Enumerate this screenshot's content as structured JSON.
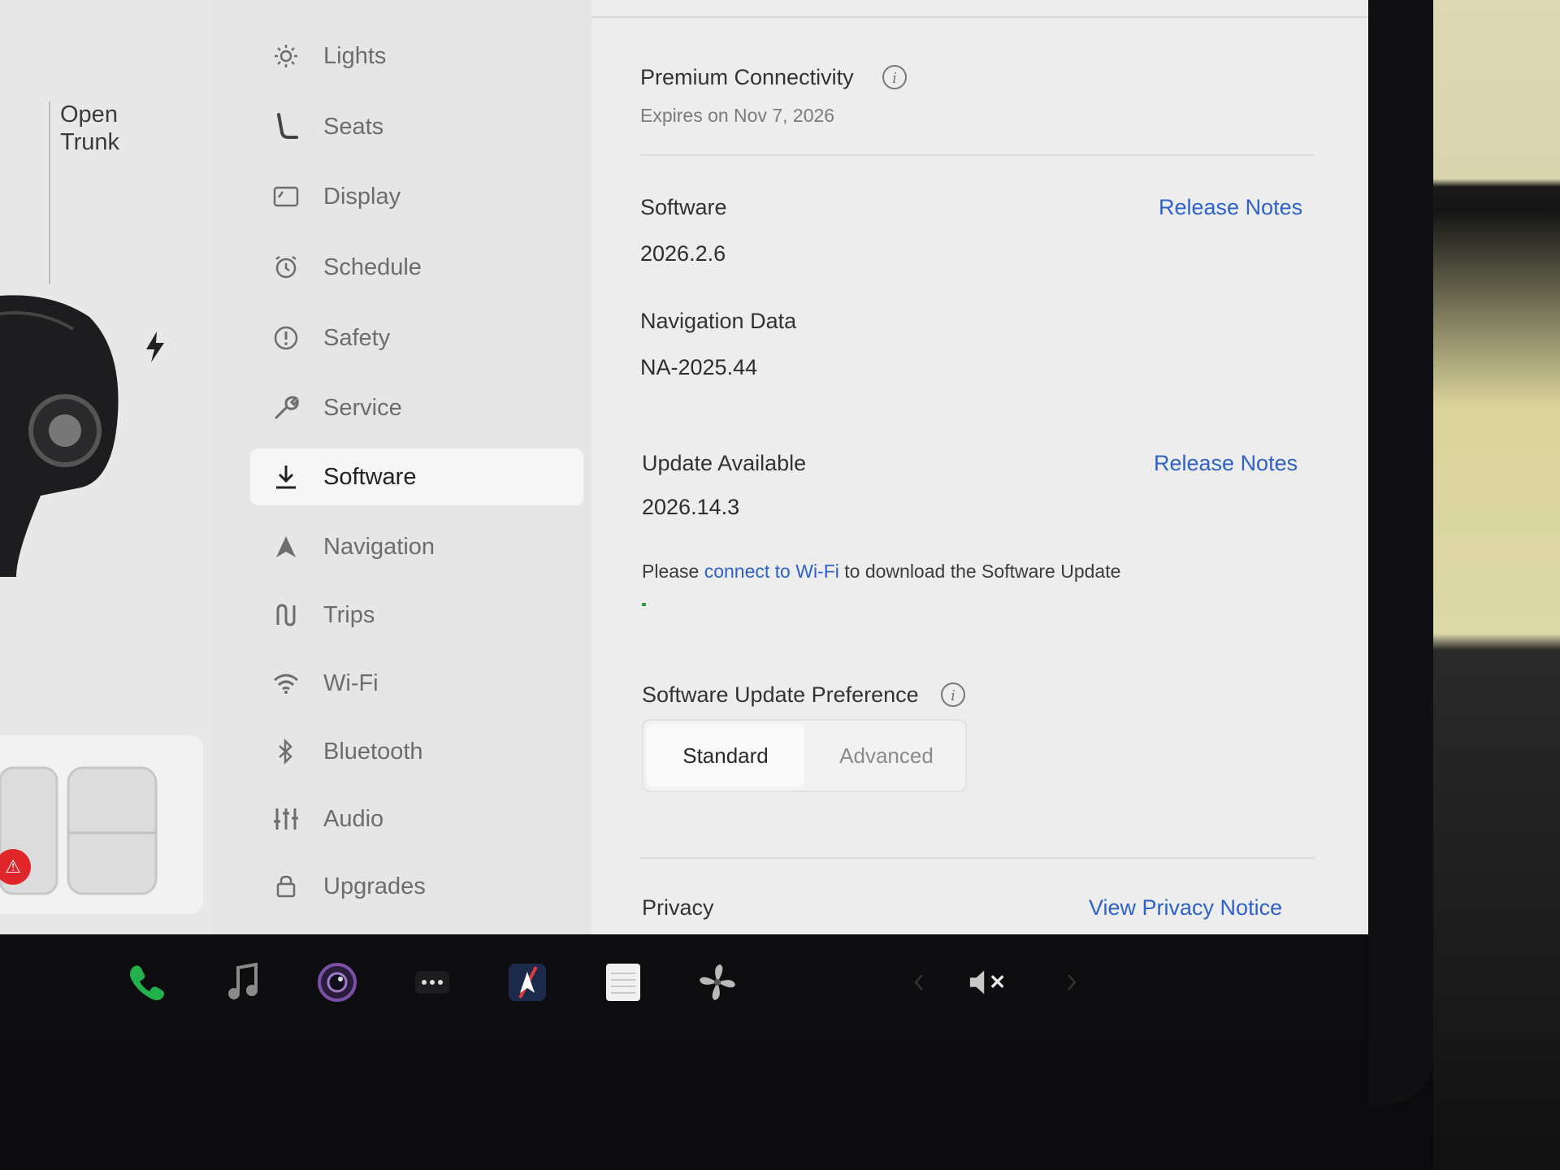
{
  "car_panel": {
    "trunk_label": "Open\nTrunk"
  },
  "menu": {
    "items": [
      {
        "label": "Lights",
        "icon": "lights-icon"
      },
      {
        "label": "Seats",
        "icon": "seat-icon"
      },
      {
        "label": "Display",
        "icon": "display-icon"
      },
      {
        "label": "Schedule",
        "icon": "schedule-icon"
      },
      {
        "label": "Safety",
        "icon": "safety-icon"
      },
      {
        "label": "Service",
        "icon": "wrench-icon"
      },
      {
        "label": "Software",
        "icon": "download-icon",
        "active": true
      },
      {
        "label": "Navigation",
        "icon": "navigation-icon"
      },
      {
        "label": "Trips",
        "icon": "trips-icon"
      },
      {
        "label": "Wi-Fi",
        "icon": "wifi-icon"
      },
      {
        "label": "Bluetooth",
        "icon": "bluetooth-icon"
      },
      {
        "label": "Audio",
        "icon": "audio-icon"
      },
      {
        "label": "Upgrades",
        "icon": "upgrades-icon"
      }
    ]
  },
  "connectivity": {
    "title": "Premium Connectivity",
    "expires": "Expires on Nov 7, 2026"
  },
  "software": {
    "title": "Software",
    "version": "2026.2.6",
    "release_notes": "Release Notes"
  },
  "navigation_data": {
    "title": "Navigation Data",
    "version": "NA-2025.44"
  },
  "update": {
    "title": "Update Available",
    "version": "2026.14.3",
    "release_notes": "Release Notes",
    "message_prefix": "Please ",
    "message_link": "connect to Wi-Fi",
    "message_suffix": " to download the Software Update",
    "progress_fraction": 0.01,
    "progress_color": "#2e9b44"
  },
  "preference": {
    "title": "Software Update Preference",
    "options": [
      "Standard",
      "Advanced"
    ],
    "selected": "Standard"
  },
  "privacy": {
    "title": "Privacy",
    "link": "View Privacy Notice"
  },
  "dock": {
    "icons": [
      "phone-icon",
      "music-icon",
      "camera-icon",
      "more-icon",
      "navigation-app-icon",
      "notes-icon",
      "fan-icon",
      "volume-muted-icon"
    ]
  },
  "colors": {
    "accent": "#2e62c9",
    "alert": "#e0262b",
    "phone": "#22b14c"
  }
}
